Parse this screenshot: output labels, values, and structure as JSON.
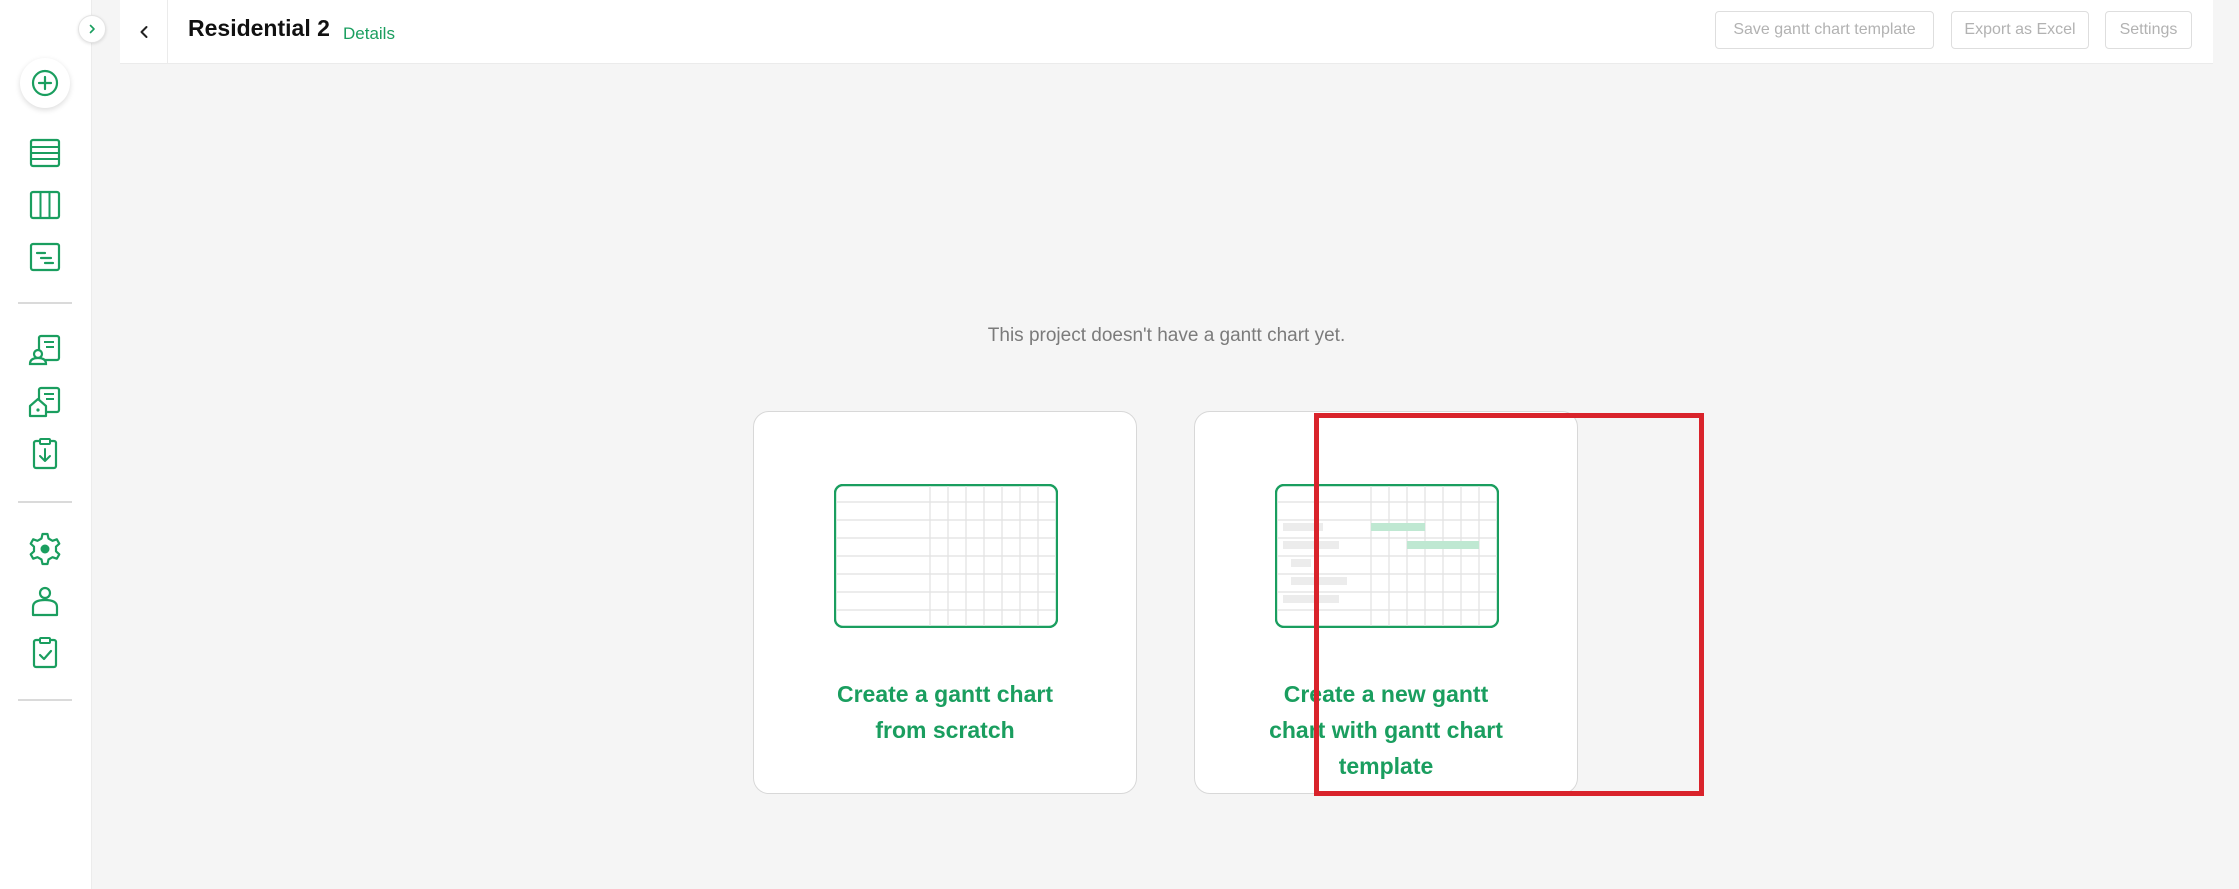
{
  "colors": {
    "brand": "#1a9e5f",
    "highlight": "#d9232b",
    "muted_text": "#7b7b7b"
  },
  "sidebar": {
    "expand_icon": "chevron-right-icon",
    "add_icon": "plus-circle-icon",
    "groups": [
      [
        "list-view-icon",
        "board-view-icon",
        "gantt-view-icon"
      ],
      [
        "contact-document-icon",
        "home-document-icon",
        "download-clipboard-icon"
      ],
      [
        "settings-icon",
        "user-icon",
        "checked-clipboard-icon"
      ]
    ]
  },
  "header": {
    "back_icon": "chevron-left-icon",
    "title": "Residential 2",
    "details_link": "Details",
    "buttons": {
      "save_template": "Save gantt chart template",
      "export_excel": "Export as Excel",
      "settings": "Settings"
    }
  },
  "main": {
    "empty_message": "This project doesn't have a gantt chart yet.",
    "options": [
      {
        "label_lines": [
          "Create a gantt chart",
          "from scratch"
        ],
        "illustration": "empty-grid-icon"
      },
      {
        "label_lines": [
          "Create a new gantt",
          "chart with gantt chart",
          "template"
        ],
        "illustration": "template-grid-icon",
        "highlighted": true
      }
    ]
  }
}
